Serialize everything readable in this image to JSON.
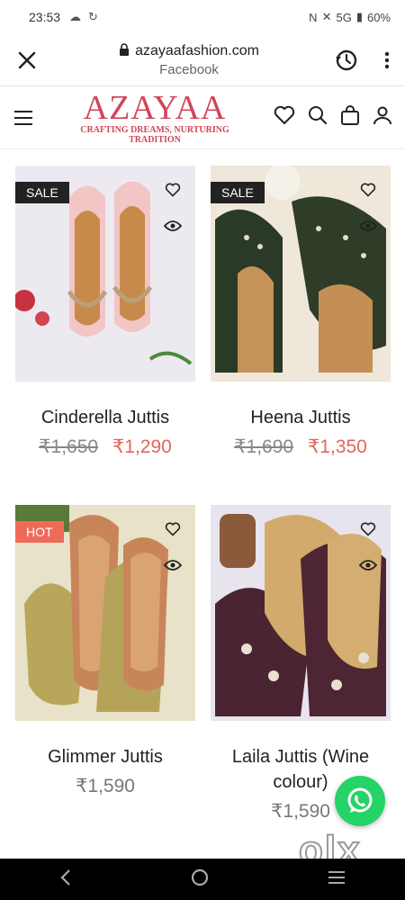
{
  "status_bar": {
    "time": "23:53",
    "network": "5G",
    "battery": "60%"
  },
  "browser": {
    "url": "azayaafashion.com",
    "source": "Facebook"
  },
  "site": {
    "logo_main": "AZAYAA",
    "logo_tagline_1": "CRAFTING DREAMS, NURTURING",
    "logo_tagline_2": "TRADITION"
  },
  "products": [
    {
      "badge": "SALE",
      "name": "Cinderella Juttis",
      "old_price": "₹1,650",
      "price": "₹1,290"
    },
    {
      "badge": "SALE",
      "name": "Heena Juttis",
      "old_price": "₹1,690",
      "price": "₹1,350"
    },
    {
      "badge": "HOT",
      "name": "Glimmer Juttis",
      "old_price": "",
      "price": "₹1,590"
    },
    {
      "badge": "",
      "name_line1": "Laila Juttis (Wine",
      "name_line2": "colour)",
      "old_price": "",
      "price": "₹1,590"
    }
  ],
  "watermark": "olx",
  "colors": {
    "brand": "#d2455a",
    "sale_price": "#e0665a",
    "hot_badge": "#ee6b5a",
    "whatsapp": "#25d366"
  }
}
